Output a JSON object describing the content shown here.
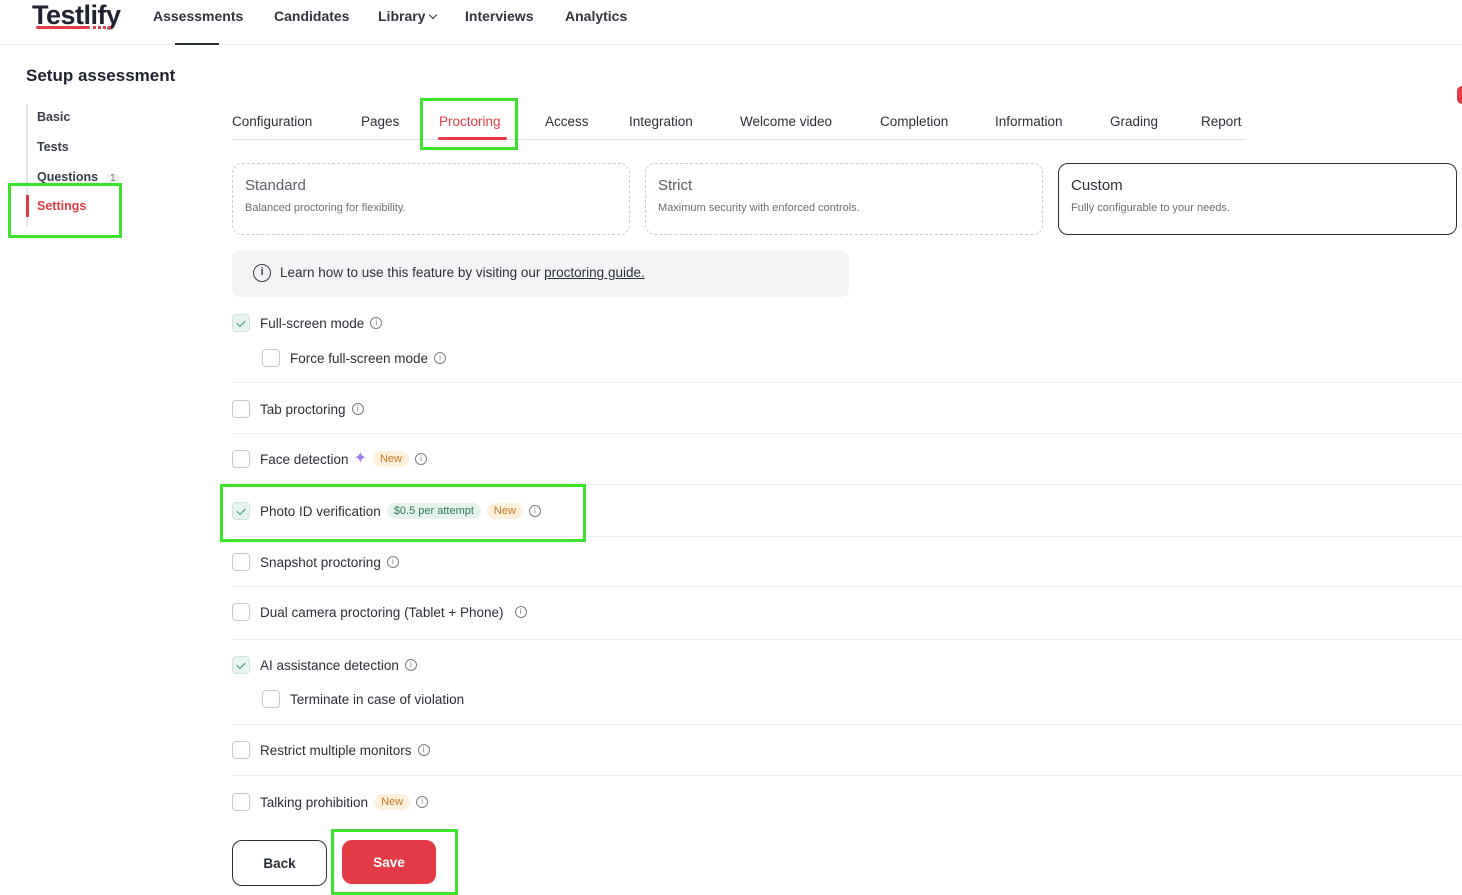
{
  "app": {
    "logo": "Testlify",
    "nav": [
      {
        "label": "Assessments"
      },
      {
        "label": "Candidates"
      },
      {
        "label": "Library"
      },
      {
        "label": "Interviews"
      },
      {
        "label": "Analytics"
      }
    ]
  },
  "page_title": "Setup assessment",
  "sidebar": {
    "items": [
      {
        "label": "Basic"
      },
      {
        "label": "Tests"
      },
      {
        "label": "Questions",
        "count": "1"
      },
      {
        "label": "Settings",
        "active": true
      }
    ]
  },
  "tabs": [
    {
      "label": "Configuration"
    },
    {
      "label": "Pages"
    },
    {
      "label": "Proctoring",
      "active": true
    },
    {
      "label": "Access"
    },
    {
      "label": "Integration"
    },
    {
      "label": "Welcome video"
    },
    {
      "label": "Completion"
    },
    {
      "label": "Information"
    },
    {
      "label": "Grading"
    },
    {
      "label": "Report"
    }
  ],
  "modes": [
    {
      "title": "Standard",
      "desc": "Balanced proctoring for flexibility.",
      "selected": false
    },
    {
      "title": "Strict",
      "desc": "Maximum security with enforced controls.",
      "selected": false
    },
    {
      "title": "Custom",
      "desc": "Fully configurable to your needs.",
      "selected": true
    }
  ],
  "info": {
    "text": "Learn how to use this feature by visiting our ",
    "link": "proctoring guide."
  },
  "options": {
    "fullscreen": {
      "label": "Full-screen mode",
      "checked": true
    },
    "force_fullscreen": {
      "label": "Force full-screen mode",
      "checked": false
    },
    "tab": {
      "label": "Tab proctoring",
      "checked": false
    },
    "face": {
      "label": "Face detection",
      "badge": "New",
      "checked": false
    },
    "photo_id": {
      "label": "Photo ID verification",
      "price": "$0.5 per attempt",
      "badge": "New",
      "checked": true
    },
    "snapshot": {
      "label": "Snapshot proctoring",
      "checked": false
    },
    "dual_camera": {
      "label": "Dual camera proctoring (Tablet + Phone)",
      "checked": false
    },
    "ai_assist": {
      "label": "AI assistance detection",
      "checked": true
    },
    "terminate": {
      "label": "Terminate in case of violation",
      "checked": false
    },
    "monitors": {
      "label": "Restrict multiple monitors",
      "checked": false
    },
    "talking": {
      "label": "Talking prohibition",
      "badge": "New",
      "checked": false
    }
  },
  "buttons": {
    "back": "Back",
    "save": "Save"
  },
  "colors": {
    "accent": "#e23b45",
    "highlight": "#3be32c",
    "check_green": "#3c9670"
  },
  "icons": {
    "info": "i",
    "sparkle": "✦"
  }
}
